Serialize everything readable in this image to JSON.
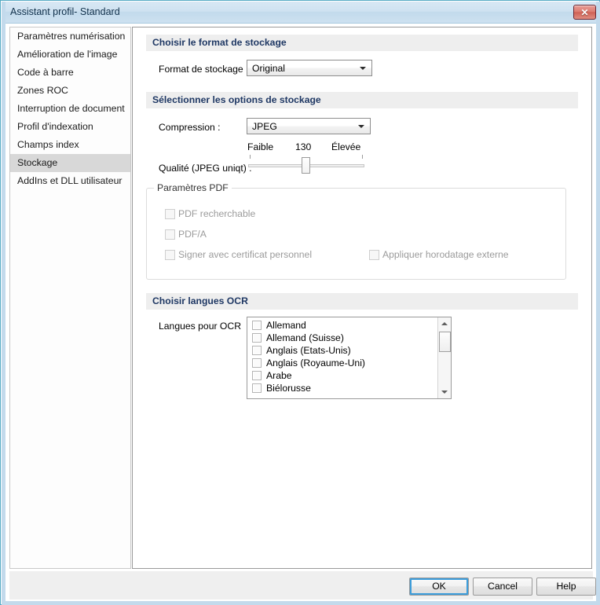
{
  "window": {
    "title": "Assistant profil- Standard",
    "close_label": "✕",
    "close_icon": "close-icon"
  },
  "sidebar": {
    "items": [
      {
        "label": "Paramètres numérisation",
        "selected": false
      },
      {
        "label": "Amélioration de l'image",
        "selected": false
      },
      {
        "label": "Code à barre",
        "selected": false
      },
      {
        "label": "Zones ROC",
        "selected": false
      },
      {
        "label": "Interruption de document",
        "selected": false
      },
      {
        "label": "Profil d'indexation",
        "selected": false
      },
      {
        "label": "Champs index",
        "selected": false
      },
      {
        "label": "Stockage",
        "selected": true
      },
      {
        "label": "AddIns et DLL utilisateur",
        "selected": false
      }
    ]
  },
  "sections": {
    "storage_format": {
      "header": "Choisir le format de stockage",
      "format_label": "Format de stockage :",
      "format_value": "Original"
    },
    "storage_options": {
      "header": "Sélectionner les options de stockage",
      "compression_label": "Compression :",
      "compression_value": "JPEG",
      "quality_label": "Qualité (JPEG uniqt) :",
      "quality_low": "Faible",
      "quality_value": "130",
      "quality_high": "Élevée",
      "quality_percent": 50,
      "pdf_group": {
        "title": "Paramètres PDF",
        "checkboxes": [
          {
            "label": "PDF recherchable",
            "checked": false,
            "disabled": true
          },
          {
            "label": "PDF/A",
            "checked": false,
            "disabled": true
          },
          {
            "label": "Signer avec certificat personnel",
            "checked": false,
            "disabled": true
          },
          {
            "label": "Appliquer horodatage externe",
            "checked": false,
            "disabled": true
          }
        ]
      }
    },
    "ocr": {
      "header": "Choisir langues OCR",
      "languages_label": "Langues pour OCR",
      "languages": [
        {
          "label": "Allemand",
          "checked": false
        },
        {
          "label": "Allemand (Suisse)",
          "checked": false
        },
        {
          "label": "Anglais (Etats-Unis)",
          "checked": false
        },
        {
          "label": "Anglais (Royaume-Uni)",
          "checked": false
        },
        {
          "label": "Arabe",
          "checked": false
        },
        {
          "label": "Biélorusse",
          "checked": false
        }
      ],
      "scroll_up_icon": "triangle-up-icon",
      "scroll_down_icon": "triangle-down-icon"
    }
  },
  "footer": {
    "ok_label": "OK",
    "cancel_label": "Cancel",
    "help_label": "Help"
  },
  "colors": {
    "titlebar": "#c8dff0",
    "section_header_bg": "#eeeeee",
    "section_header_text": "#1f3864",
    "selection": "#d8d8d8",
    "focus_ring": "#3c9ddb",
    "close_button": "#cf6155"
  }
}
